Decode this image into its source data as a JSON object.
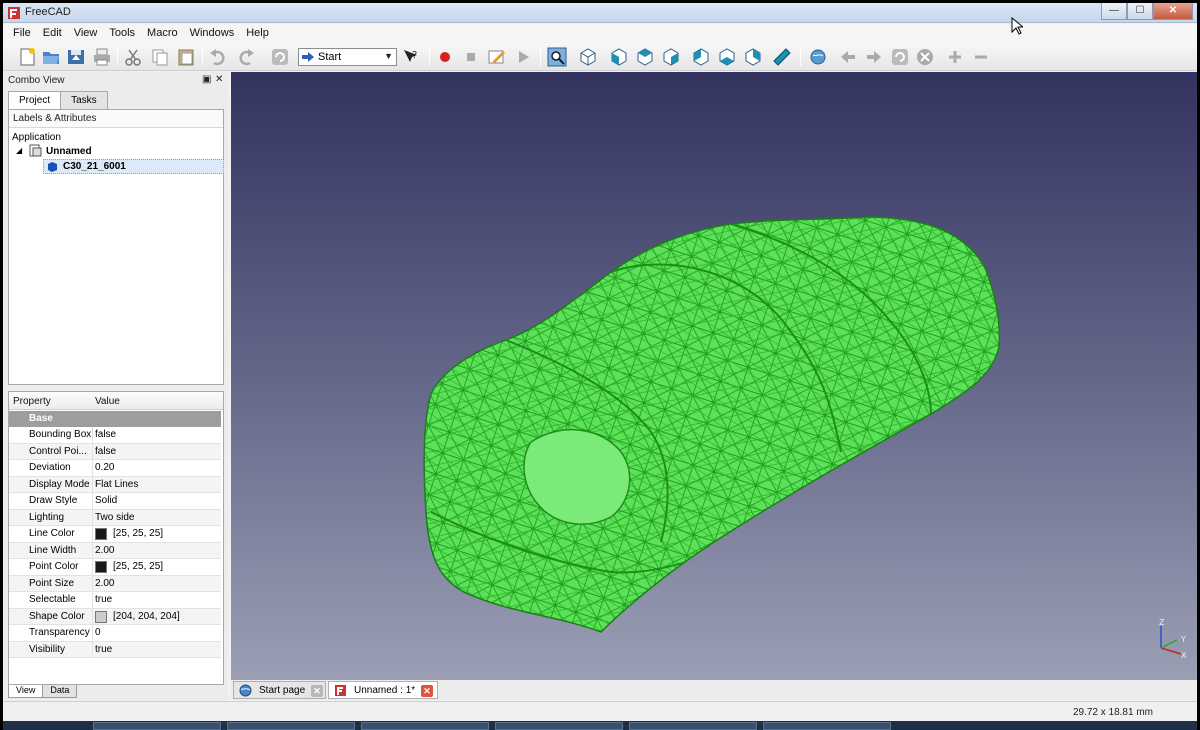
{
  "window": {
    "title": "FreeCAD",
    "min": "—",
    "max": "☐",
    "close": "✕"
  },
  "menu": [
    "File",
    "Edit",
    "View",
    "Tools",
    "Macro",
    "Windows",
    "Help"
  ],
  "toolbar": {
    "workbench": "Start",
    "icons": [
      "new-document-icon",
      "open-icon",
      "save-icon",
      "print-icon",
      "cut-icon",
      "copy-icon",
      "paste-icon",
      "undo-icon",
      "redo-icon",
      "refresh-icon",
      "whats-this-icon",
      "record-macro-icon",
      "stop-macro-icon",
      "edit-macro-icon",
      "run-macro-icon",
      "fit-all-icon",
      "axonometric-view-icon",
      "front-view-icon",
      "top-view-icon",
      "right-view-icon",
      "rear-view-icon",
      "bottom-view-icon",
      "left-view-icon",
      "measure-icon",
      "web-home-icon",
      "web-back-icon",
      "web-forward-icon",
      "web-refresh-icon",
      "web-stop-icon",
      "zoom-in-icon",
      "zoom-out-icon"
    ]
  },
  "combo_view": {
    "title": "Combo View",
    "tabs": [
      "Project",
      "Tasks"
    ],
    "active_tab": "Project",
    "tree": {
      "header": "Labels & Attributes",
      "root": "Application",
      "document": "Unnamed",
      "object": "C30_21_6001"
    },
    "properties": {
      "header_property": "Property",
      "header_value": "Value",
      "group": "Base",
      "rows": [
        {
          "name": "Bounding Box",
          "value": "false"
        },
        {
          "name": "Control Poi...",
          "value": "false"
        },
        {
          "name": "Deviation",
          "value": "0.20"
        },
        {
          "name": "Display Mode",
          "value": "Flat Lines"
        },
        {
          "name": "Draw Style",
          "value": "Solid"
        },
        {
          "name": "Lighting",
          "value": "Two side"
        },
        {
          "name": "Line Color",
          "value": "[25, 25, 25]",
          "swatch": "#191919"
        },
        {
          "name": "Line Width",
          "value": "2.00"
        },
        {
          "name": "Point Color",
          "value": "[25, 25, 25]",
          "swatch": "#191919"
        },
        {
          "name": "Point Size",
          "value": "2.00"
        },
        {
          "name": "Selectable",
          "value": "true"
        },
        {
          "name": "Shape Color",
          "value": "[204, 204, 204]",
          "swatch": "#cccccc"
        },
        {
          "name": "Transparency",
          "value": "0"
        },
        {
          "name": "Visibility",
          "value": "true"
        }
      ]
    },
    "bottom_tabs": [
      "View",
      "Data"
    ]
  },
  "viewport": {
    "mesh_color": "#5de15a",
    "line_color": "#22a61f",
    "axis_labels": {
      "x": "X",
      "y": "Y",
      "z": "Z"
    }
  },
  "document_tabs": [
    {
      "label": "Start page",
      "close": "✕"
    },
    {
      "label": "Unnamed : 1*",
      "close": "✕"
    }
  ],
  "status": {
    "dimensions": "29.72 x 18.81 mm"
  }
}
